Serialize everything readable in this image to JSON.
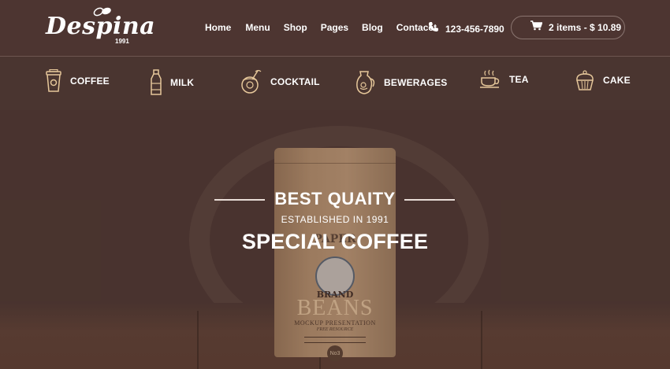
{
  "brand": {
    "name": "Despina",
    "year": "1991"
  },
  "nav": {
    "items": [
      {
        "label": "Home"
      },
      {
        "label": "Menu"
      },
      {
        "label": "Shop"
      },
      {
        "label": "Pages"
      },
      {
        "label": "Blog"
      },
      {
        "label": "Contacet"
      }
    ]
  },
  "contact": {
    "phone": "123-456-7890",
    "icon": "phone-icon"
  },
  "cart": {
    "label": "2 items - $ 10.89",
    "icon": "cart-icon"
  },
  "categories": [
    {
      "label": "COFFEE",
      "icon": "coffee-cup-icon"
    },
    {
      "label": "MILK",
      "icon": "milk-bottle-icon"
    },
    {
      "label": "COCKTAIL",
      "icon": "coconut-cocktail-icon"
    },
    {
      "label": "BEWERAGES",
      "icon": "jug-icon"
    },
    {
      "label": "TEA",
      "icon": "tea-cup-icon"
    },
    {
      "label": "CAKE",
      "icon": "cupcake-icon"
    }
  ],
  "hero": {
    "title": "BEST QUAITY",
    "subtitle": "ESTABLISHED IN 1991",
    "headline": "SPECIAL COFFEE"
  },
  "product_image": {
    "brand_top": "PAPER",
    "brand": "BRAND",
    "name": "BEANS",
    "caption": "MOCKUP PRESENTATION",
    "caption2": "FREE RESOURCE",
    "number": "No3"
  },
  "colors": {
    "background": "#4a3530",
    "header": "#4d3531",
    "text": "#ffffff",
    "bag": "#b89470"
  }
}
